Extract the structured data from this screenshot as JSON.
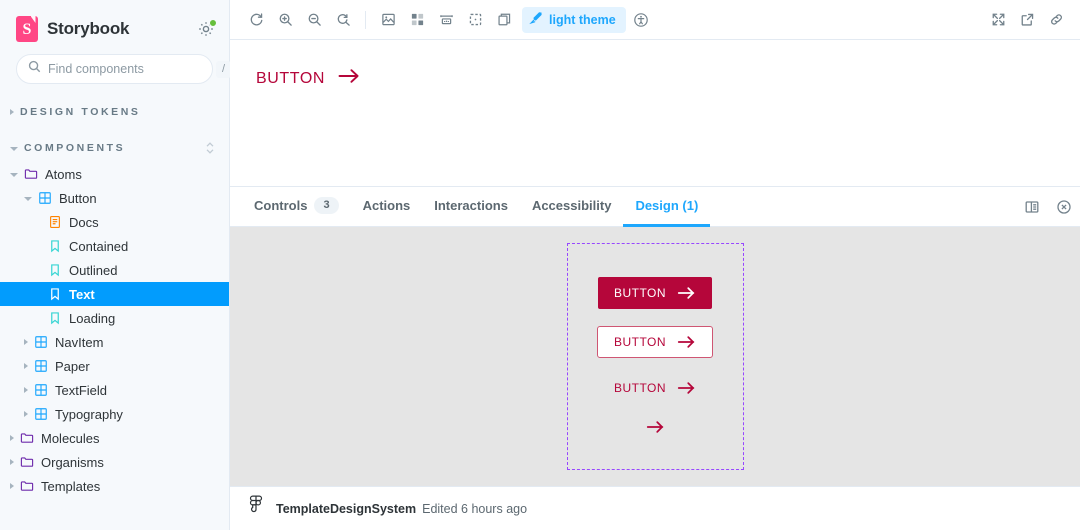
{
  "sidebar": {
    "brand": "Storybook",
    "search": {
      "placeholder": "Find components",
      "value": "",
      "shortcut": "/"
    },
    "sections": [
      {
        "label": "DESIGN TOKENS",
        "expanded": false
      },
      {
        "label": "COMPONENTS",
        "expanded": true
      }
    ],
    "tree": [
      {
        "label": "Atoms",
        "icon": "folder-icon",
        "depth": 0,
        "expanded": true,
        "selected": false
      },
      {
        "label": "Button",
        "icon": "component-icon",
        "depth": 1,
        "expanded": true,
        "selected": false
      },
      {
        "label": "Docs",
        "icon": "document-icon",
        "depth": 2,
        "expanded": null,
        "selected": false
      },
      {
        "label": "Contained",
        "icon": "story-icon",
        "depth": 2,
        "expanded": null,
        "selected": false
      },
      {
        "label": "Outlined",
        "icon": "story-icon",
        "depth": 2,
        "expanded": null,
        "selected": false
      },
      {
        "label": "Text",
        "icon": "story-icon",
        "depth": 2,
        "expanded": null,
        "selected": true
      },
      {
        "label": "Loading",
        "icon": "story-icon",
        "depth": 2,
        "expanded": null,
        "selected": false
      },
      {
        "label": "NavItem",
        "icon": "component-icon",
        "depth": 1,
        "expanded": false,
        "selected": false
      },
      {
        "label": "Paper",
        "icon": "component-icon",
        "depth": 1,
        "expanded": false,
        "selected": false
      },
      {
        "label": "TextField",
        "icon": "component-icon",
        "depth": 1,
        "expanded": false,
        "selected": false
      },
      {
        "label": "Typography",
        "icon": "component-icon",
        "depth": 1,
        "expanded": false,
        "selected": false
      },
      {
        "label": "Molecules",
        "icon": "folder-icon",
        "depth": 0,
        "expanded": false,
        "selected": false
      },
      {
        "label": "Organisms",
        "icon": "folder-icon",
        "depth": 0,
        "expanded": false,
        "selected": false
      },
      {
        "label": "Templates",
        "icon": "folder-icon",
        "depth": 0,
        "expanded": false,
        "selected": false
      }
    ]
  },
  "toolbar": {
    "left_icons": [
      "remount-icon",
      "zoom-in-icon",
      "zoom-out-icon",
      "zoom-reset-icon"
    ],
    "addon_icons": [
      "background-icon",
      "grid-icon",
      "measure-icon",
      "outline-icon",
      "viewport-icon"
    ],
    "theme_label": "light theme",
    "theme_icon": "paintbrush-icon",
    "a11y_icon": "accessibility-icon",
    "right_icons": [
      "fullscreen-icon",
      "open-new-tab-icon",
      "copy-link-icon"
    ]
  },
  "preview": {
    "button_label": "BUTTON",
    "arrow": "→",
    "accent_color": "#b5063a"
  },
  "panel": {
    "tabs": [
      {
        "label": "Controls",
        "badge": "3",
        "active": false
      },
      {
        "label": "Actions",
        "badge": null,
        "active": false
      },
      {
        "label": "Interactions",
        "badge": null,
        "active": false
      },
      {
        "label": "Accessibility",
        "badge": null,
        "active": false
      },
      {
        "label": "Design (1)",
        "badge": null,
        "active": true
      }
    ],
    "actions": [
      "panel-position-icon",
      "close-panel-icon"
    ],
    "design": {
      "frame_border_color": "#9747ff",
      "background": "#e5e5e5",
      "buttons": [
        {
          "label": "BUTTON",
          "variant": "contained",
          "arrow": "→"
        },
        {
          "label": "BUTTON",
          "variant": "outlined",
          "arrow": "→"
        },
        {
          "label": "BUTTON",
          "variant": "text",
          "arrow": "→"
        },
        {
          "label": "",
          "variant": "icon",
          "arrow": "→"
        }
      ],
      "footer": {
        "icon": "figma-icon",
        "file_name": "TemplateDesignSystem",
        "edited": "Edited 6 hours ago"
      }
    }
  }
}
